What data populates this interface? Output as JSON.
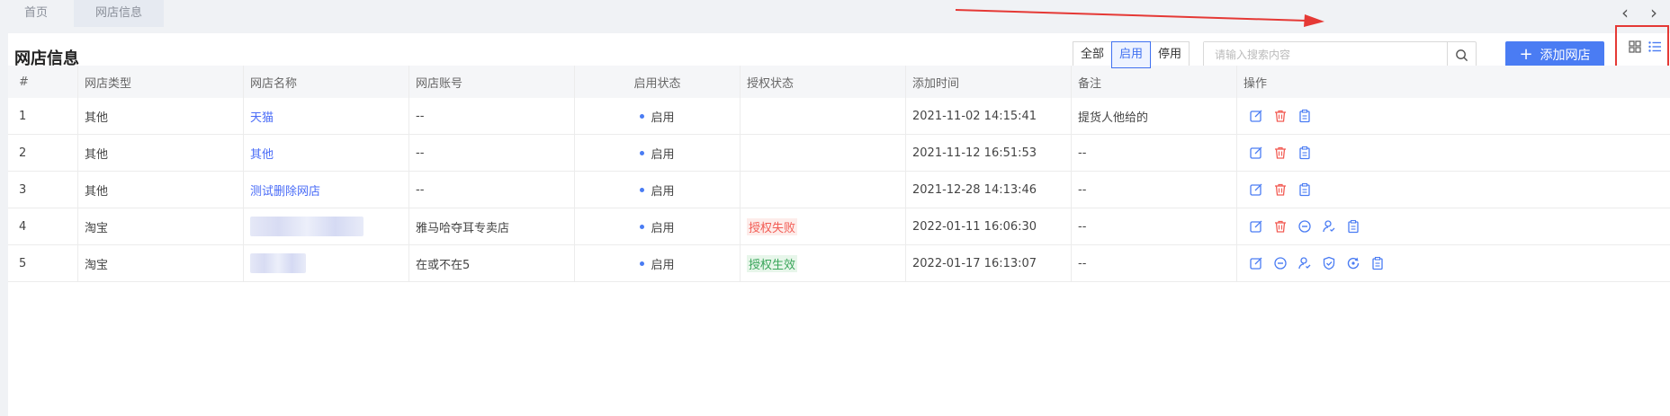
{
  "tabs": {
    "home": "首页",
    "active": "网店信息"
  },
  "page_title": "网店信息",
  "filters": [
    "全部",
    "启用",
    "停用"
  ],
  "active_filter_index": 1,
  "search": {
    "placeholder": "请输入搜索内容",
    "value": ""
  },
  "add_button": "添加网店",
  "columns": [
    "#",
    "网店类型",
    "网店名称",
    "网店账号",
    "启用状态",
    "授权状态",
    "添加时间",
    "备注",
    "操作"
  ],
  "rows": [
    {
      "index": "1",
      "type": "其他",
      "name": "天猫",
      "name_blurred": false,
      "account": "--",
      "status": "启用",
      "auth": "",
      "auth_kind": "",
      "added": "2021-11-02 14:15:41",
      "note": "提货人他给的",
      "actions": [
        "edit-icon",
        "delete-icon",
        "copy-icon"
      ]
    },
    {
      "index": "2",
      "type": "其他",
      "name": "其他",
      "name_blurred": false,
      "account": "--",
      "status": "启用",
      "auth": "",
      "auth_kind": "",
      "added": "2021-11-12 16:51:53",
      "note": "--",
      "actions": [
        "edit-icon",
        "delete-icon",
        "copy-icon"
      ]
    },
    {
      "index": "3",
      "type": "其他",
      "name": "测试删除网店",
      "name_blurred": false,
      "account": "--",
      "status": "启用",
      "auth": "",
      "auth_kind": "",
      "added": "2021-12-28 14:13:46",
      "note": "--",
      "actions": [
        "edit-icon",
        "delete-icon",
        "copy-icon"
      ]
    },
    {
      "index": "4",
      "type": "淘宝",
      "name": "",
      "name_blurred": true,
      "account": "雅马哈夺耳专卖店",
      "status": "启用",
      "auth": "授权失败",
      "auth_kind": "fail",
      "added": "2022-01-11 16:06:30",
      "note": "--",
      "actions": [
        "edit-icon",
        "delete-icon",
        "disable-icon",
        "authorize-user-icon",
        "copy-icon"
      ]
    },
    {
      "index": "5",
      "type": "淘宝",
      "name": "",
      "name_blurred": true,
      "account": "在或不在5",
      "status": "启用",
      "auth": "授权生效",
      "auth_kind": "ok",
      "added": "2022-01-17 16:13:07",
      "note": "--",
      "actions": [
        "edit-icon",
        "disable-icon",
        "authorize-user-icon",
        "shield-check-icon",
        "refresh-auth-icon",
        "copy-icon"
      ]
    }
  ],
  "colors": {
    "accent": "#4a7cf3",
    "link": "#4a6cf7",
    "auth_fail": "#f25c54",
    "auth_ok": "#3aa55a",
    "delete": "#f25c54",
    "annotation": "#e53935"
  }
}
